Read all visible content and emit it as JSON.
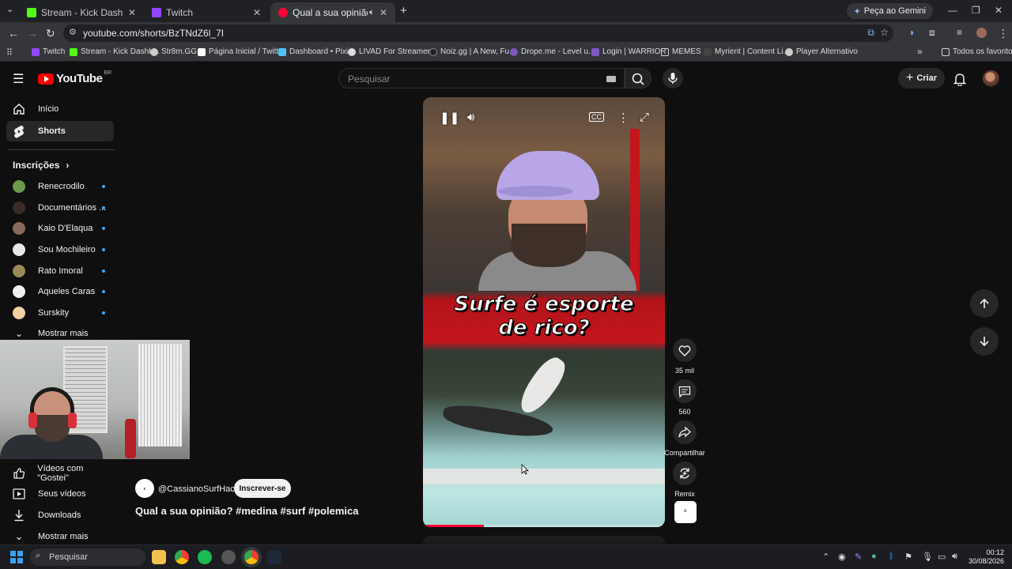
{
  "browser": {
    "tabs": [
      {
        "label": "Stream - Kick Dashboard",
        "color": "#53fc18"
      },
      {
        "label": "Twitch",
        "color": "#9146ff"
      },
      {
        "label": "Qual a sua opinião? #medi",
        "color": "#ff0033"
      }
    ],
    "gemini_label": "Peça ao Gemini",
    "url": "youtube.com/shorts/BzTNdZ6l_7I",
    "bookmarks": [
      {
        "label": "Twitch",
        "color": "#9146ff"
      },
      {
        "label": "Stream - Kick Dashb...",
        "color": "#53fc18"
      },
      {
        "label": "Str8m.GG",
        "color": "#cccccc"
      },
      {
        "label": "Página Inicial / Twitter",
        "color": "#ffffff"
      },
      {
        "label": "Dashboard • Pixie",
        "color": "#4fc3f7"
      },
      {
        "label": "LIVAD For Streamer...",
        "color": "#dddddd"
      },
      {
        "label": "Noiz.gg | A New, Fu...",
        "color": "#222222"
      },
      {
        "label": "Drope.me - Level u...",
        "color": "#7e57c2"
      },
      {
        "label": "Login | WARRIOR",
        "color": "#7e57c2"
      },
      {
        "label": "MEMES",
        "color": "#d0d0d0"
      },
      {
        "label": "Myrient | Content Li...",
        "color": "#444444"
      },
      {
        "label": "Player Alternativo",
        "color": "#cccccc"
      }
    ],
    "all_bookmarks": "Todos os favoritos"
  },
  "yt": {
    "logo_word": "YouTube",
    "country": "BR",
    "search_placeholder": "Pesquisar",
    "create_label": "Criar",
    "sidebar": {
      "home": "Início",
      "shorts": "Shorts",
      "subscriptions": "Inscrições",
      "subs": [
        {
          "name": "Renecrodilo",
          "color": "#6a9a4a"
        },
        {
          "name": "Documentários ...",
          "color": "#3a2a28"
        },
        {
          "name": "Kaio D'Elaqua",
          "color": "#8a6a5a"
        },
        {
          "name": "Sou Mochileiro",
          "color": "#e8e8e8"
        },
        {
          "name": "Rato Imoral",
          "color": "#9a8a5a"
        },
        {
          "name": "Aqueles Caras",
          "color": "#f0f0f0"
        },
        {
          "name": "Surskity",
          "color": "#f2d0a0"
        }
      ],
      "show_more": "Mostrar mais",
      "liked": "Vídeos com \"Gostei\"",
      "your_videos": "Seus vídeos",
      "downloads": "Downloads",
      "show_more_2": "Mostrar mais"
    },
    "short": {
      "headline_1": "Surfe é esporte",
      "headline_2": "de rico?",
      "progress": 0.25,
      "likes": "35 mil",
      "comments": "560",
      "share": "Compartilhar",
      "remix": "Remix",
      "channel": "@CassianoSurfHacks",
      "subscribe": "Inscrever-se",
      "title": "Qual a sua opinião? #medina #surf #polemica"
    }
  },
  "taskbar": {
    "search": "Pesquisar",
    "time": "00:12",
    "date": "30/08/2026"
  }
}
